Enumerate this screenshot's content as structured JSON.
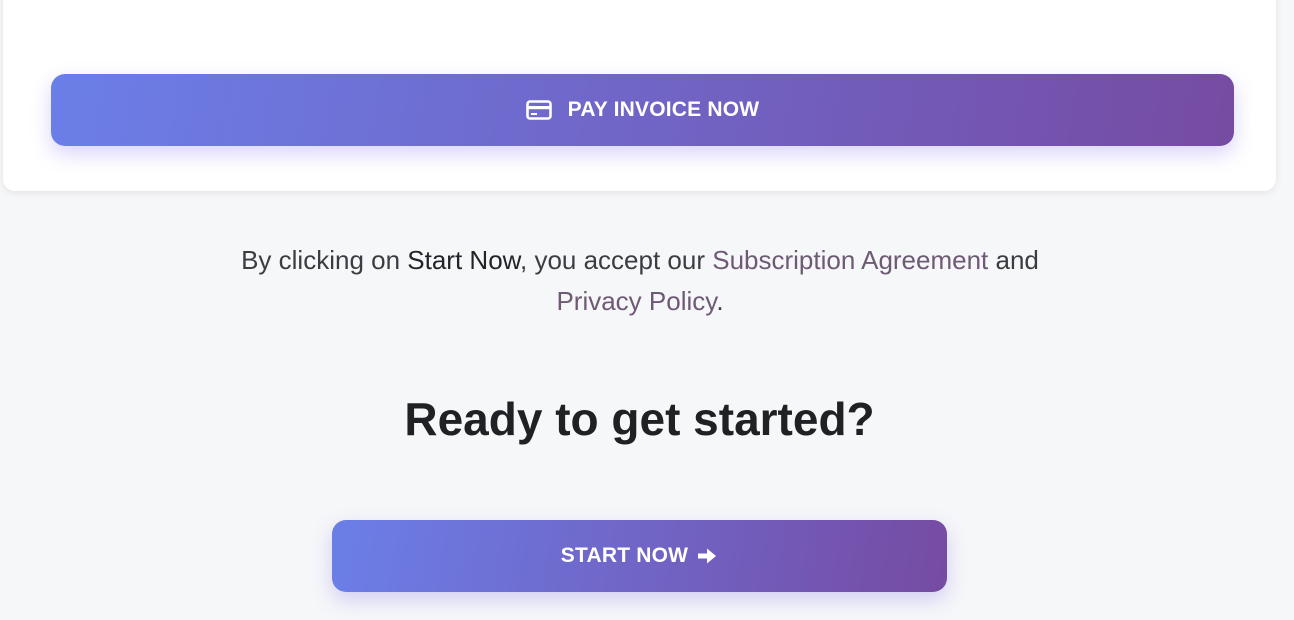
{
  "payment_card": {
    "pay_button": {
      "label": "PAY INVOICE NOW",
      "icon": "credit-card-icon"
    }
  },
  "terms": {
    "prefix": "By clicking on ",
    "start_now": "Start Now",
    "middle": ", you accept our ",
    "subscription_link": "Subscription Agreement",
    "and": " and",
    "privacy_link": "Privacy Policy",
    "suffix": "."
  },
  "cta": {
    "heading": "Ready to get started?",
    "start_button": {
      "label": "START NOW",
      "icon": "arrow-right-icon"
    }
  },
  "colors": {
    "gradient_start": "#6b7fe8",
    "gradient_end": "#764ba2",
    "link": "#6f5a76",
    "background": "#f6f7f9"
  }
}
